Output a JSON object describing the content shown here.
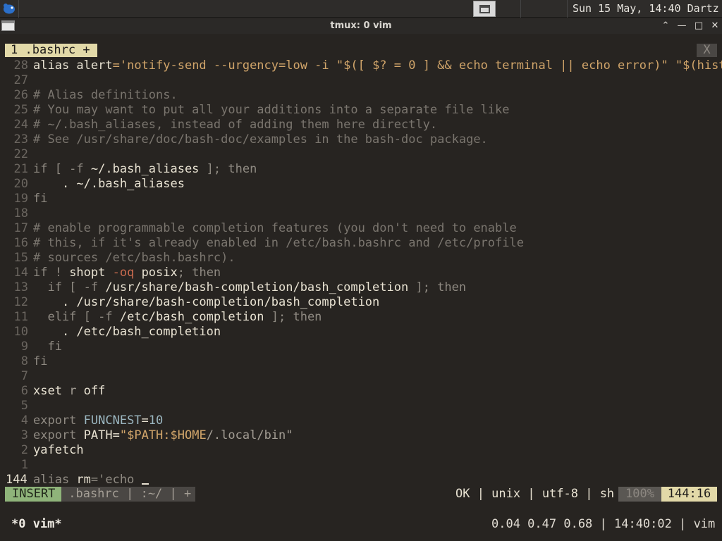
{
  "panel": {
    "logo_icon": "xfce-mouse-icon",
    "task_icon": "window-icon",
    "clock": "Sun 15 May, 14:40",
    "user": "Dartz"
  },
  "window": {
    "title": "tmux: 0 vim",
    "controls": {
      "shade": "⌃",
      "minimize": "—",
      "maximize": "□",
      "close": "✕"
    }
  },
  "vim": {
    "tab_label": "1 .bashrc +",
    "tab_close": "X",
    "lines": [
      {
        "n": "28",
        "segs": [
          [
            "id",
            "alias "
          ],
          [
            "id",
            "alert"
          ],
          [
            "str",
            "='notify-send --urgency=low -i \"$([ $? = 0 ] && echo terminal || echo error)\" \"$(hist"
          ],
          [
            "trunc",
            "»"
          ]
        ]
      },
      {
        "n": "27",
        "segs": []
      },
      {
        "n": "26",
        "segs": [
          [
            "cmt",
            "# Alias definitions."
          ]
        ]
      },
      {
        "n": "25",
        "segs": [
          [
            "cmt",
            "# You may want to put all your additions into a separate file like"
          ]
        ]
      },
      {
        "n": "24",
        "segs": [
          [
            "cmt",
            "# ~/.bash_aliases, instead of adding them here directly."
          ]
        ]
      },
      {
        "n": "23",
        "segs": [
          [
            "cmt",
            "# See /usr/share/doc/bash-doc/examples in the bash-doc package."
          ]
        ]
      },
      {
        "n": "22",
        "segs": []
      },
      {
        "n": "21",
        "segs": [
          [
            "kw",
            "if [ -f "
          ],
          [
            "id",
            "~/.bash_aliases"
          ],
          [
            "kw",
            " ]; then"
          ]
        ]
      },
      {
        "n": "20",
        "segs": [
          [
            "id",
            "    . ~/.bash_aliases"
          ]
        ]
      },
      {
        "n": "19",
        "segs": [
          [
            "kw",
            "fi"
          ]
        ]
      },
      {
        "n": "18",
        "segs": []
      },
      {
        "n": "17",
        "segs": [
          [
            "cmt",
            "# enable programmable completion features (you don't need to enable"
          ]
        ]
      },
      {
        "n": "16",
        "segs": [
          [
            "cmt",
            "# this, if it's already enabled in /etc/bash.bashrc and /etc/profile"
          ]
        ]
      },
      {
        "n": "15",
        "segs": [
          [
            "cmt",
            "# sources /etc/bash.bashrc)."
          ]
        ]
      },
      {
        "n": "14",
        "segs": [
          [
            "kw",
            "if ! "
          ],
          [
            "id",
            "shopt "
          ],
          [
            "opt",
            "-oq"
          ],
          [
            "id",
            " posix"
          ],
          [
            "kw",
            "; then"
          ]
        ]
      },
      {
        "n": "13",
        "segs": [
          [
            "kw",
            "  if [ -f "
          ],
          [
            "id",
            "/usr/share/bash-completion/bash_completion"
          ],
          [
            "kw",
            " ]; then"
          ]
        ]
      },
      {
        "n": "12",
        "segs": [
          [
            "id",
            "    . /usr/share/bash-completion/bash_completion"
          ]
        ]
      },
      {
        "n": "11",
        "segs": [
          [
            "kw",
            "  elif [ -f "
          ],
          [
            "id",
            "/etc/bash_completion"
          ],
          [
            "kw",
            " ]; then"
          ]
        ]
      },
      {
        "n": "10",
        "segs": [
          [
            "id",
            "    . /etc/bash_completion"
          ]
        ]
      },
      {
        "n": "9",
        "segs": [
          [
            "kw",
            "  fi"
          ]
        ]
      },
      {
        "n": "8",
        "segs": [
          [
            "kw",
            "fi"
          ]
        ]
      },
      {
        "n": "7",
        "segs": []
      },
      {
        "n": "6",
        "segs": [
          [
            "id",
            "xset "
          ],
          [
            "dim",
            "r"
          ],
          [
            "id",
            " off"
          ]
        ]
      },
      {
        "n": "5",
        "segs": []
      },
      {
        "n": "4",
        "segs": [
          [
            "kw",
            "export "
          ],
          [
            "var",
            "FUNCNEST"
          ],
          [
            "id",
            "="
          ],
          [
            "num",
            "10"
          ]
        ]
      },
      {
        "n": "3",
        "segs": [
          [
            "kw",
            "export "
          ],
          [
            "id",
            "PATH"
          ],
          [
            "id",
            "="
          ],
          [
            "str",
            "\"$PATH:$HOME"
          ],
          [
            "dim",
            "/.local/bin\""
          ]
        ]
      },
      {
        "n": "2",
        "segs": [
          [
            "id",
            "yafetch"
          ]
        ]
      },
      {
        "n": "1",
        "segs": []
      },
      {
        "n": "144",
        "segs": [
          [
            "kw",
            "alias "
          ],
          [
            "id",
            "rm"
          ],
          [
            "kw",
            "='echo "
          ]
        ],
        "cursor": true
      }
    ],
    "status": {
      "mode": "INSERT",
      "file": " .bashrc | :~/ | +",
      "info": "OK | unix | utf-8 | sh",
      "percent": "100%",
      "position": "144:16"
    }
  },
  "tmux": {
    "window": "*0 vim*",
    "right": "0.04 0.47 0.68 | 14:40:02 | vim"
  },
  "colors": {
    "background": "#272421",
    "tab_bg": "#e2d9a8",
    "insert_bg": "#8fb47a",
    "comment": "#7a756e",
    "string": "#d1a56a",
    "number": "#9bb6c0",
    "option": "#c96a4e"
  }
}
